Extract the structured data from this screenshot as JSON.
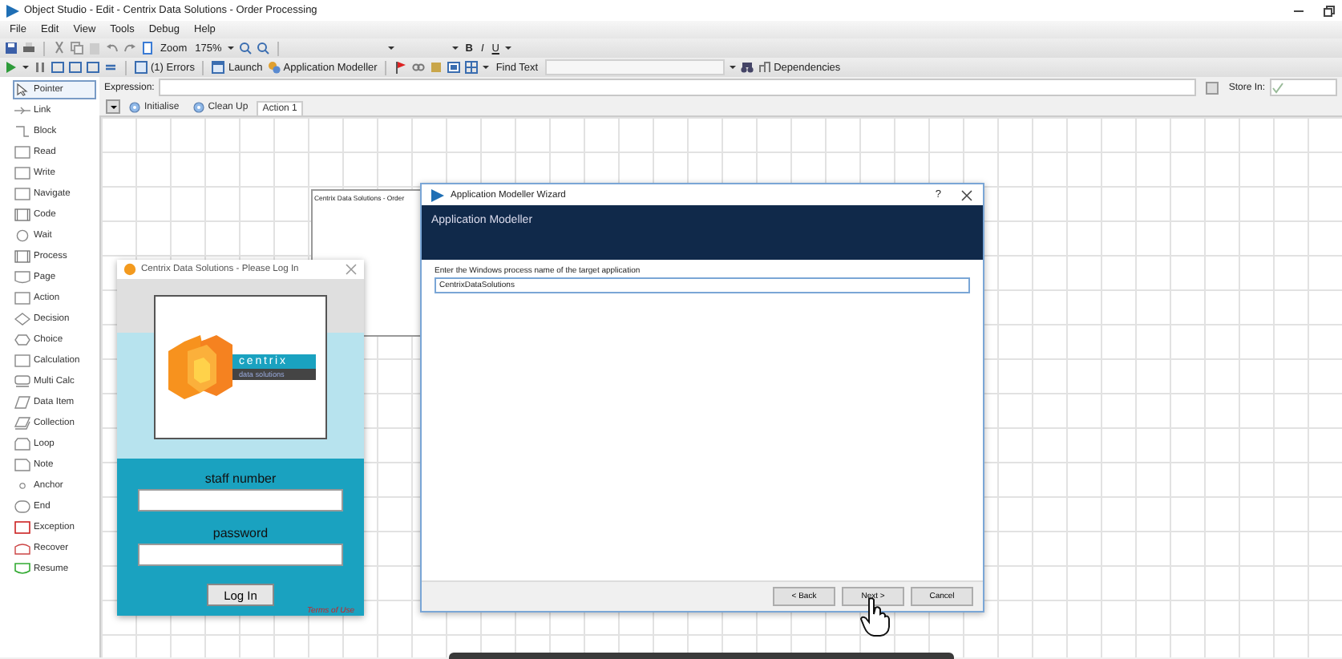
{
  "window": {
    "title": "Object Studio - Edit - Centrix Data Solutions - Order Processing"
  },
  "menu": [
    "File",
    "Edit",
    "View",
    "Tools",
    "Debug",
    "Help"
  ],
  "toolbar": {
    "zoom_label": "Zoom",
    "zoom_value": "175%",
    "bold": "B",
    "italic": "I",
    "underline": "U",
    "errors": "(1) Errors",
    "launch": "Launch",
    "app_modeller": "Application Modeller",
    "find_label": "Find Text",
    "dependencies": "Dependencies"
  },
  "expression": {
    "label": "Expression:",
    "store_label": "Store In:"
  },
  "palette": [
    {
      "label": "Pointer",
      "kind": "pointer",
      "selected": true
    },
    {
      "label": "Link",
      "kind": "link",
      "selected": false
    },
    {
      "label": "Block",
      "kind": "block",
      "selected": false
    },
    {
      "label": "Read",
      "kind": "rect",
      "selected": false
    },
    {
      "label": "Write",
      "kind": "rect",
      "selected": false
    },
    {
      "label": "Navigate",
      "kind": "rect",
      "selected": false
    },
    {
      "label": "Code",
      "kind": "code",
      "selected": false
    },
    {
      "label": "Wait",
      "kind": "circle",
      "selected": false
    },
    {
      "label": "Process",
      "kind": "code",
      "selected": false
    },
    {
      "label": "Page",
      "kind": "page",
      "selected": false
    },
    {
      "label": "Action",
      "kind": "rect",
      "selected": false
    },
    {
      "label": "Decision",
      "kind": "diamond",
      "selected": false
    },
    {
      "label": "Choice",
      "kind": "hexagon",
      "selected": false
    },
    {
      "label": "Calculation",
      "kind": "rect",
      "selected": false
    },
    {
      "label": "Multi Calc",
      "kind": "multi",
      "selected": false
    },
    {
      "label": "Data Item",
      "kind": "parallelogram",
      "selected": false
    },
    {
      "label": "Collection",
      "kind": "collection",
      "selected": false
    },
    {
      "label": "Loop",
      "kind": "loop",
      "selected": false
    },
    {
      "label": "Note",
      "kind": "note",
      "selected": false
    },
    {
      "label": "Anchor",
      "kind": "anchor",
      "selected": false
    },
    {
      "label": "End",
      "kind": "end",
      "selected": false
    },
    {
      "label": "Exception",
      "kind": "exception",
      "selected": false
    },
    {
      "label": "Recover",
      "kind": "recover",
      "selected": false
    },
    {
      "label": "Resume",
      "kind": "resume",
      "selected": false
    }
  ],
  "tabs": [
    {
      "label": "Initialise",
      "kind": "system",
      "selected": false
    },
    {
      "label": "Clean Up",
      "kind": "system",
      "selected": false
    },
    {
      "label": "Action 1",
      "kind": "page",
      "selected": true
    }
  ],
  "stage": {
    "title": "Centrix Data Solutions - Order"
  },
  "login_window": {
    "title": "Centrix Data Solutions - Please Log In",
    "logo": {
      "name": "centrix",
      "tagline": "data solutions"
    },
    "fields": [
      {
        "label": "staff number"
      },
      {
        "label": "password"
      }
    ],
    "button": "Log In",
    "link": "Terms of Use"
  },
  "wizard": {
    "title": "Application Modeller Wizard",
    "help": "?",
    "heading": "Application Modeller",
    "prompt": "Enter the Windows process name of the target application",
    "value": "CentrixDataSolutions",
    "buttons": [
      "< Back",
      "Next >",
      "Cancel"
    ]
  }
}
